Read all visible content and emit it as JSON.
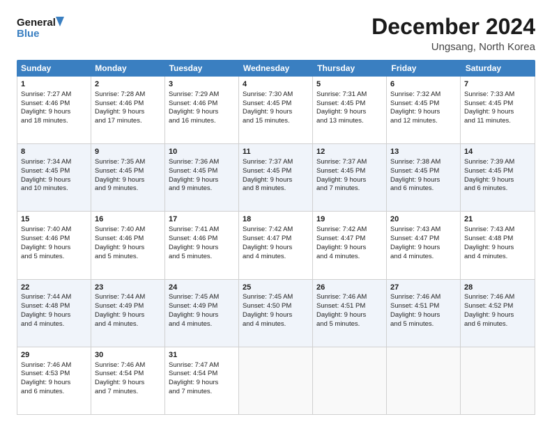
{
  "logo": {
    "text_general": "General",
    "text_blue": "Blue"
  },
  "title": "December 2024",
  "subtitle": "Ungsang, North Korea",
  "header_days": [
    "Sunday",
    "Monday",
    "Tuesday",
    "Wednesday",
    "Thursday",
    "Friday",
    "Saturday"
  ],
  "weeks": [
    {
      "alt": false,
      "days": [
        {
          "num": "1",
          "lines": [
            "Sunrise: 7:27 AM",
            "Sunset: 4:46 PM",
            "Daylight: 9 hours",
            "and 18 minutes."
          ]
        },
        {
          "num": "2",
          "lines": [
            "Sunrise: 7:28 AM",
            "Sunset: 4:46 PM",
            "Daylight: 9 hours",
            "and 17 minutes."
          ]
        },
        {
          "num": "3",
          "lines": [
            "Sunrise: 7:29 AM",
            "Sunset: 4:46 PM",
            "Daylight: 9 hours",
            "and 16 minutes."
          ]
        },
        {
          "num": "4",
          "lines": [
            "Sunrise: 7:30 AM",
            "Sunset: 4:45 PM",
            "Daylight: 9 hours",
            "and 15 minutes."
          ]
        },
        {
          "num": "5",
          "lines": [
            "Sunrise: 7:31 AM",
            "Sunset: 4:45 PM",
            "Daylight: 9 hours",
            "and 13 minutes."
          ]
        },
        {
          "num": "6",
          "lines": [
            "Sunrise: 7:32 AM",
            "Sunset: 4:45 PM",
            "Daylight: 9 hours",
            "and 12 minutes."
          ]
        },
        {
          "num": "7",
          "lines": [
            "Sunrise: 7:33 AM",
            "Sunset: 4:45 PM",
            "Daylight: 9 hours",
            "and 11 minutes."
          ]
        }
      ]
    },
    {
      "alt": true,
      "days": [
        {
          "num": "8",
          "lines": [
            "Sunrise: 7:34 AM",
            "Sunset: 4:45 PM",
            "Daylight: 9 hours",
            "and 10 minutes."
          ]
        },
        {
          "num": "9",
          "lines": [
            "Sunrise: 7:35 AM",
            "Sunset: 4:45 PM",
            "Daylight: 9 hours",
            "and 9 minutes."
          ]
        },
        {
          "num": "10",
          "lines": [
            "Sunrise: 7:36 AM",
            "Sunset: 4:45 PM",
            "Daylight: 9 hours",
            "and 9 minutes."
          ]
        },
        {
          "num": "11",
          "lines": [
            "Sunrise: 7:37 AM",
            "Sunset: 4:45 PM",
            "Daylight: 9 hours",
            "and 8 minutes."
          ]
        },
        {
          "num": "12",
          "lines": [
            "Sunrise: 7:37 AM",
            "Sunset: 4:45 PM",
            "Daylight: 9 hours",
            "and 7 minutes."
          ]
        },
        {
          "num": "13",
          "lines": [
            "Sunrise: 7:38 AM",
            "Sunset: 4:45 PM",
            "Daylight: 9 hours",
            "and 6 minutes."
          ]
        },
        {
          "num": "14",
          "lines": [
            "Sunrise: 7:39 AM",
            "Sunset: 4:45 PM",
            "Daylight: 9 hours",
            "and 6 minutes."
          ]
        }
      ]
    },
    {
      "alt": false,
      "days": [
        {
          "num": "15",
          "lines": [
            "Sunrise: 7:40 AM",
            "Sunset: 4:46 PM",
            "Daylight: 9 hours",
            "and 5 minutes."
          ]
        },
        {
          "num": "16",
          "lines": [
            "Sunrise: 7:40 AM",
            "Sunset: 4:46 PM",
            "Daylight: 9 hours",
            "and 5 minutes."
          ]
        },
        {
          "num": "17",
          "lines": [
            "Sunrise: 7:41 AM",
            "Sunset: 4:46 PM",
            "Daylight: 9 hours",
            "and 5 minutes."
          ]
        },
        {
          "num": "18",
          "lines": [
            "Sunrise: 7:42 AM",
            "Sunset: 4:47 PM",
            "Daylight: 9 hours",
            "and 4 minutes."
          ]
        },
        {
          "num": "19",
          "lines": [
            "Sunrise: 7:42 AM",
            "Sunset: 4:47 PM",
            "Daylight: 9 hours",
            "and 4 minutes."
          ]
        },
        {
          "num": "20",
          "lines": [
            "Sunrise: 7:43 AM",
            "Sunset: 4:47 PM",
            "Daylight: 9 hours",
            "and 4 minutes."
          ]
        },
        {
          "num": "21",
          "lines": [
            "Sunrise: 7:43 AM",
            "Sunset: 4:48 PM",
            "Daylight: 9 hours",
            "and 4 minutes."
          ]
        }
      ]
    },
    {
      "alt": true,
      "days": [
        {
          "num": "22",
          "lines": [
            "Sunrise: 7:44 AM",
            "Sunset: 4:48 PM",
            "Daylight: 9 hours",
            "and 4 minutes."
          ]
        },
        {
          "num": "23",
          "lines": [
            "Sunrise: 7:44 AM",
            "Sunset: 4:49 PM",
            "Daylight: 9 hours",
            "and 4 minutes."
          ]
        },
        {
          "num": "24",
          "lines": [
            "Sunrise: 7:45 AM",
            "Sunset: 4:49 PM",
            "Daylight: 9 hours",
            "and 4 minutes."
          ]
        },
        {
          "num": "25",
          "lines": [
            "Sunrise: 7:45 AM",
            "Sunset: 4:50 PM",
            "Daylight: 9 hours",
            "and 4 minutes."
          ]
        },
        {
          "num": "26",
          "lines": [
            "Sunrise: 7:46 AM",
            "Sunset: 4:51 PM",
            "Daylight: 9 hours",
            "and 5 minutes."
          ]
        },
        {
          "num": "27",
          "lines": [
            "Sunrise: 7:46 AM",
            "Sunset: 4:51 PM",
            "Daylight: 9 hours",
            "and 5 minutes."
          ]
        },
        {
          "num": "28",
          "lines": [
            "Sunrise: 7:46 AM",
            "Sunset: 4:52 PM",
            "Daylight: 9 hours",
            "and 6 minutes."
          ]
        }
      ]
    },
    {
      "alt": false,
      "days": [
        {
          "num": "29",
          "lines": [
            "Sunrise: 7:46 AM",
            "Sunset: 4:53 PM",
            "Daylight: 9 hours",
            "and 6 minutes."
          ]
        },
        {
          "num": "30",
          "lines": [
            "Sunrise: 7:46 AM",
            "Sunset: 4:54 PM",
            "Daylight: 9 hours",
            "and 7 minutes."
          ]
        },
        {
          "num": "31",
          "lines": [
            "Sunrise: 7:47 AM",
            "Sunset: 4:54 PM",
            "Daylight: 9 hours",
            "and 7 minutes."
          ]
        },
        {
          "num": "",
          "lines": []
        },
        {
          "num": "",
          "lines": []
        },
        {
          "num": "",
          "lines": []
        },
        {
          "num": "",
          "lines": []
        }
      ]
    }
  ]
}
